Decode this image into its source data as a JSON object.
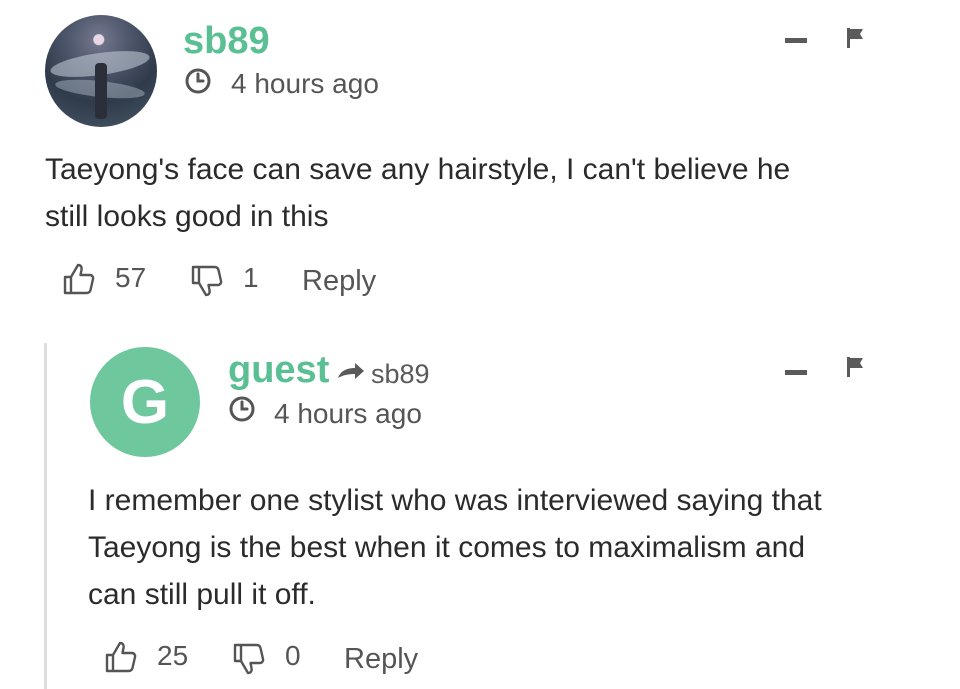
{
  "comment1": {
    "username": "sb89",
    "timestamp": "4 hours ago",
    "body_line1": "Taeyong's face can save any hairstyle, I can't believe he",
    "body_line2": "still looks good in this",
    "likes": "57",
    "dislikes": "1",
    "reply_label": "Reply"
  },
  "comment2": {
    "avatar_letter": "G",
    "username": "guest",
    "reply_to": "sb89",
    "timestamp": "4 hours ago",
    "body_line1": "I remember one stylist who was interviewed saying that",
    "body_line2": "Taeyong is the best when it comes to maximalism and",
    "body_line3": "can still pull it off.",
    "likes": "25",
    "dislikes": "0",
    "reply_label": "Reply"
  },
  "colors": {
    "username": "#5bbf94",
    "guest_avatar": "#6fc79e",
    "muted_text": "#555555"
  },
  "icons": [
    "clock-icon",
    "thumbs-up-icon",
    "thumbs-down-icon",
    "collapse-icon",
    "flag-icon",
    "reply-arrow-icon"
  ]
}
